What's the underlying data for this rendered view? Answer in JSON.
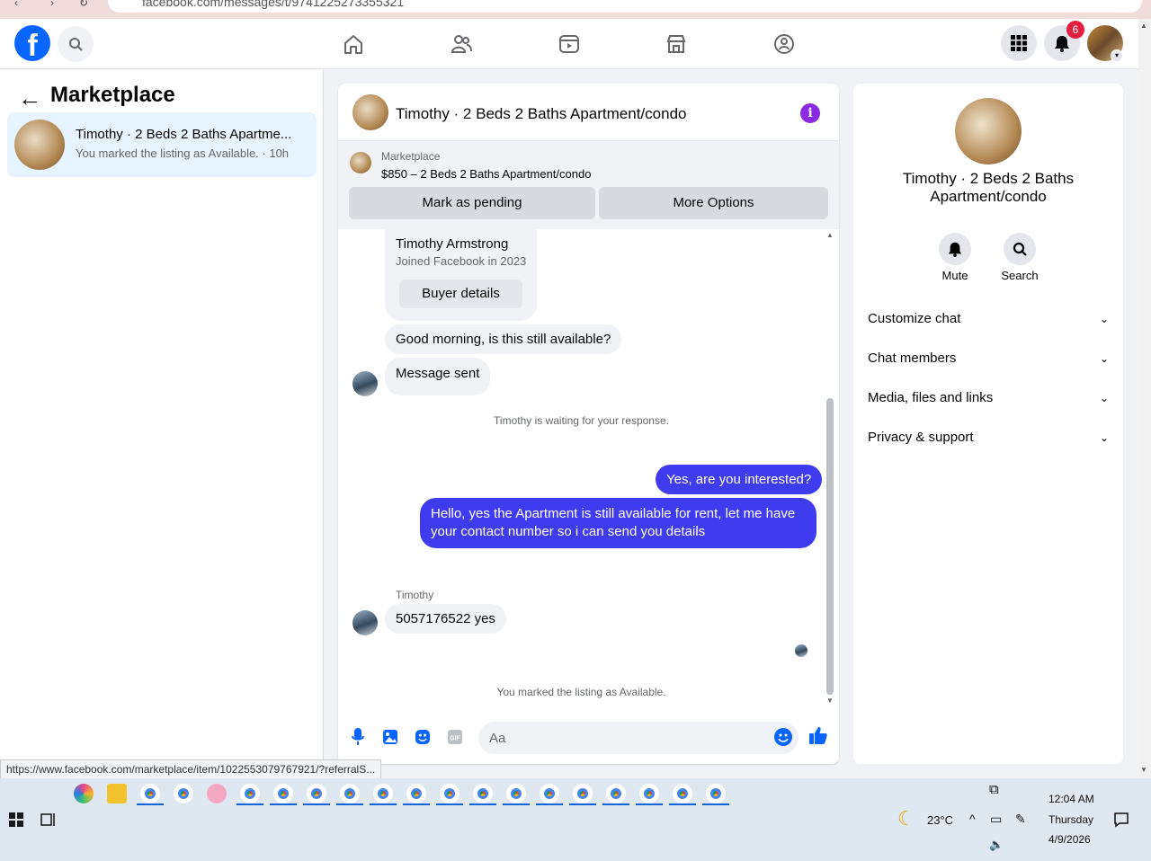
{
  "browser": {
    "url": "facebook.com/messages/t/9741225273355321"
  },
  "topbar": {
    "notification_count": "6"
  },
  "left_panel": {
    "title": "Marketplace",
    "conversations": [
      {
        "title": "Timothy · 2 Beds 2 Baths Apartme...",
        "subtitle": "You marked the listing as Available. · 10h"
      }
    ]
  },
  "chat": {
    "header_title": "Timothy · 2 Beds 2 Baths Apartment/condo",
    "listing": {
      "category": "Marketplace",
      "price_title": "$850 – 2 Beds 2 Baths Apartment/condo",
      "mark_pending_label": "Mark as pending",
      "more_options_label": "More Options"
    },
    "buyer_card": {
      "name": "Timothy Armstrong",
      "joined": "Joined Facebook in 2023",
      "button": "Buyer details"
    },
    "messages": {
      "m1": "Good morning, is this still available?",
      "m2": "Message sent",
      "waiting_note": "Timothy is waiting for your response.",
      "m3": "Yes, are you interested?",
      "m4": "Hello, yes the Apartment is still available for rent, let me have your contact number so i can send you details",
      "sender_name": "Timothy",
      "m5": "5057176522 yes",
      "listing_note": "You marked the listing as Available."
    },
    "composer_placeholder": "Aa"
  },
  "right_panel": {
    "title": "Timothy · 2 Beds 2 Baths Apartment/condo",
    "mute_label": "Mute",
    "search_label": "Search",
    "sections": [
      "Customize chat",
      "Chat members",
      "Media, files and links",
      "Privacy & support"
    ]
  },
  "status_url": "https://www.facebook.com/marketplace/item/1022553079767921/?referralS...",
  "taskbar": {
    "weather": "23°C",
    "time": "12:04 AM",
    "day": "Thursday",
    "date": "4/9/2026"
  },
  "colors": {
    "fb_blue": "#0866ff",
    "outgoing_bubble": "#3f3cf0",
    "badge_red": "#e41e3f",
    "info_purple": "#8a2be2"
  }
}
